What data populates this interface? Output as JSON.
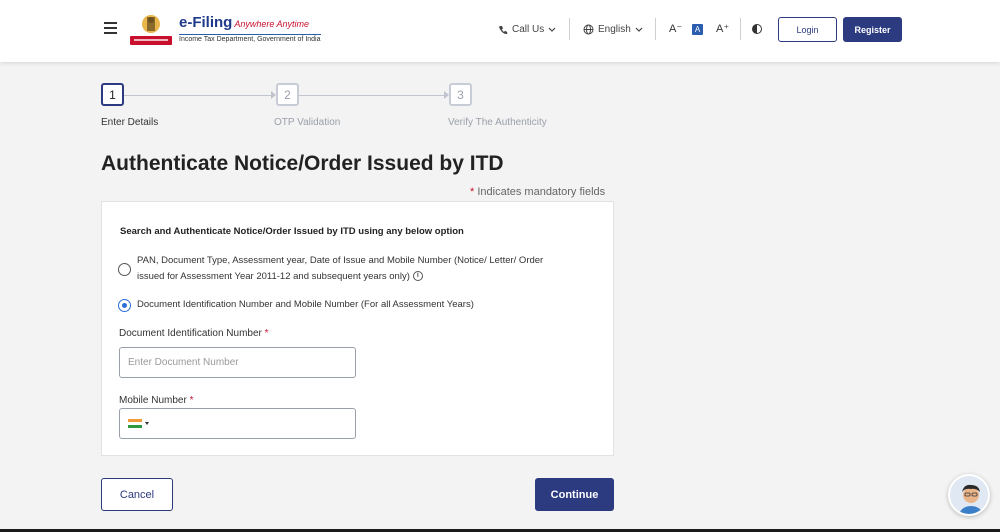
{
  "header": {
    "brand_title": "e-Filing",
    "brand_tagline": "Anywhere Anytime",
    "brand_subtitle": "Income Tax Department, Government of India",
    "call_us": "Call Us",
    "language": "English",
    "font_decrease": "A⁻",
    "font_normal": "A",
    "font_increase": "A⁺",
    "login": "Login",
    "register": "Register"
  },
  "stepper": {
    "steps": [
      {
        "number": "1",
        "label": "Enter Details",
        "active": true
      },
      {
        "number": "2",
        "label": "OTP Validation",
        "active": false
      },
      {
        "number": "3",
        "label": "Verify The Authenticity",
        "active": false
      }
    ]
  },
  "page": {
    "title": "Authenticate Notice/Order Issued by ITD",
    "mandatory_star": "*",
    "mandatory_note": " Indicates mandatory fields"
  },
  "form": {
    "heading": "Search and Authenticate Notice/Order Issued by ITD using any below option",
    "options": [
      {
        "line1": "PAN, Document Type, Assessment year, Date of Issue and Mobile Number (Notice/ Letter/ Order",
        "line2": "issued for Assessment Year 2011-12 and subsequent years only)",
        "selected": false
      },
      {
        "line1": "Document Identification Number and Mobile Number (For all Assessment Years)",
        "selected": true
      }
    ],
    "doc_number_label": "Document Identification Number",
    "doc_number_placeholder": "Enter Document Number",
    "mobile_label": "Mobile Number",
    "required_star": "*",
    "info_icon": "i"
  },
  "actions": {
    "cancel": "Cancel",
    "continue": "Continue"
  },
  "colors": {
    "primary": "#2c3a7f",
    "radio_selected": "#2a6fd6",
    "required": "#c8102e"
  },
  "icons": {
    "menu": "hamburger-icon",
    "phone": "phone-icon",
    "globe": "globe-icon",
    "contrast": "contrast-icon",
    "chatbot": "chatbot-avatar"
  }
}
